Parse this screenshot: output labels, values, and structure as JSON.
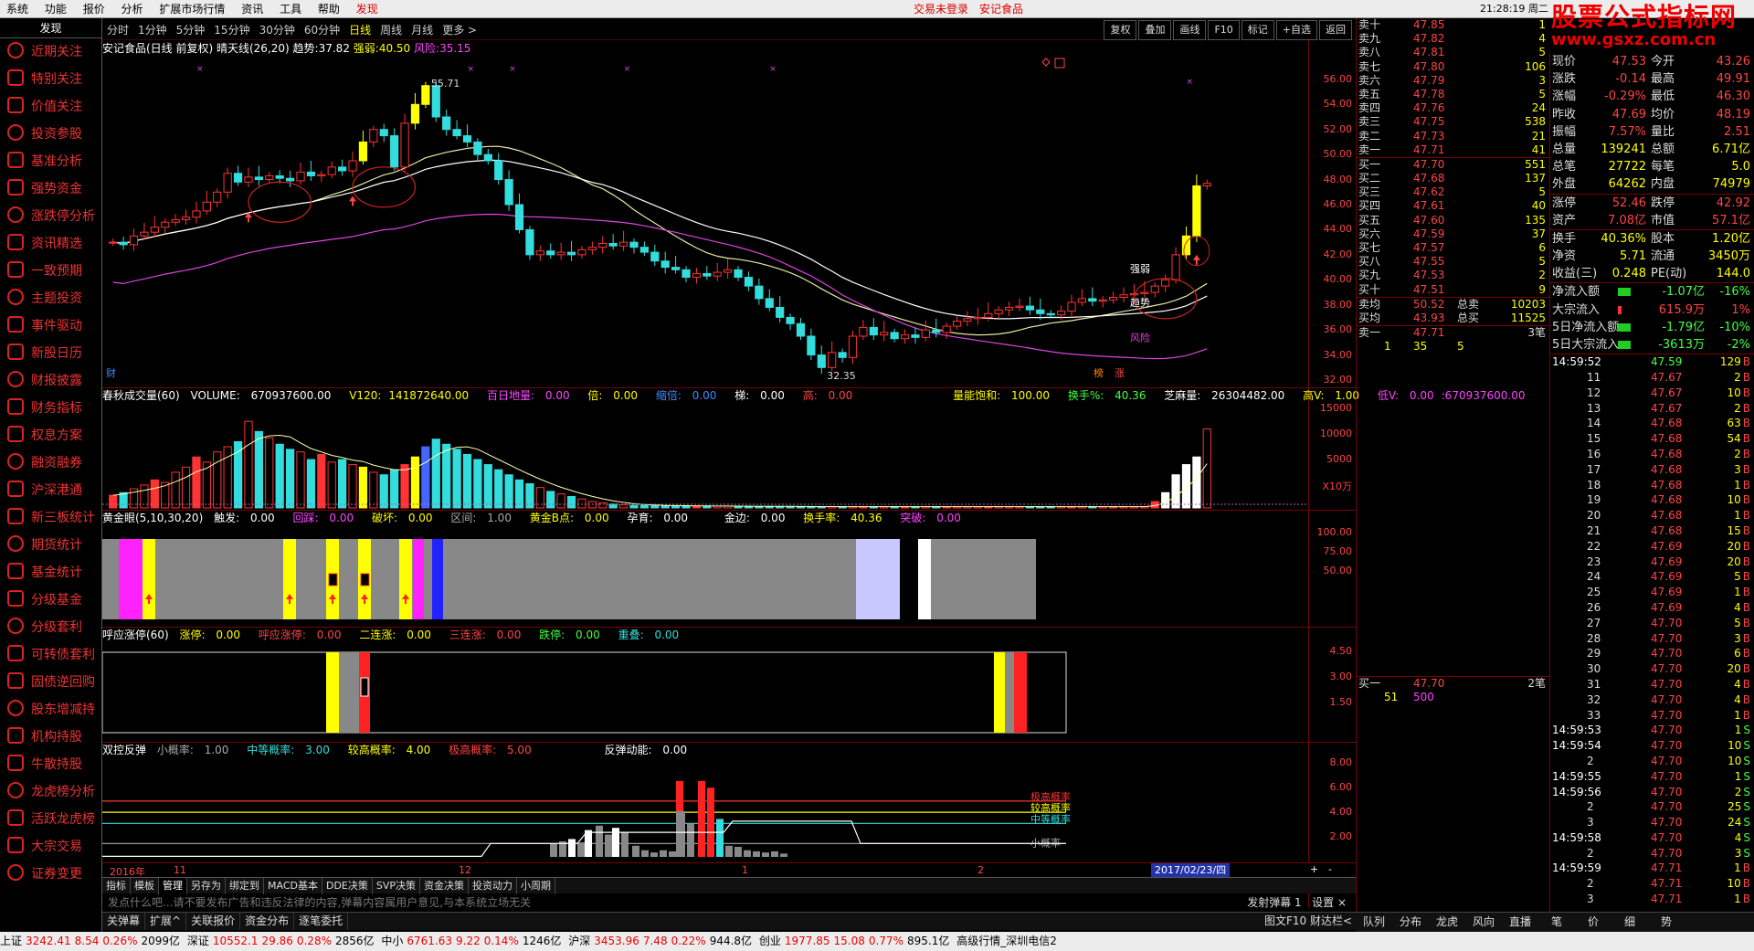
{
  "menubar": {
    "items": [
      "系统",
      "功能",
      "报价",
      "分析",
      "扩展市场行情",
      "资讯",
      "工具",
      "帮助"
    ],
    "active": "发现",
    "status1": "交易未登录",
    "status2": "安记食品",
    "time": "21:28:19 周二"
  },
  "logo": {
    "l1": "股票公式指标网",
    "l2": "www.gsxz.com.cn"
  },
  "sidebar": {
    "head": "发现",
    "items": [
      "近期关注",
      "特别关注",
      "价值关注",
      "投资参股",
      "基准分析",
      "强势资金",
      "涨跌停分析",
      "资讯精选",
      "一致预期",
      "主题投资",
      "事件驱动",
      "新股日历",
      "财报披露",
      "财务指标",
      "权息方案",
      "融资融券",
      "沪深港通",
      "新三板统计",
      "期货统计",
      "基金统计",
      "分级基金",
      "分级套利",
      "可转债套利",
      "固债逆回购",
      "股东增减持",
      "机构持股",
      "牛散持股",
      "龙虎榜分析",
      "活跃龙虎榜",
      "大宗交易",
      "证券变更"
    ]
  },
  "periodtabs": {
    "items": [
      "分时",
      "1分钟",
      "5分钟",
      "15分钟",
      "30分钟",
      "60分钟",
      "日线",
      "周线",
      "月线",
      "更多 >"
    ],
    "active": "日线",
    "right": [
      "复权",
      "叠加",
      "画线",
      "F10",
      "标记",
      "+自选",
      "返回"
    ]
  },
  "mainchart": {
    "title": "安记食品(日线 前复权) 晴天线(26,20)",
    "trend_l": "趋势:",
    "trend_v": "37.82",
    "strong_l": "强弱:",
    "strong_v": "40.50",
    "risk_l": "风险:",
    "risk_v": "35.15",
    "high_mark": "55.71",
    "low_mark": "32.35",
    "axis": [
      "56.00",
      "54.00",
      "52.00",
      "50.00",
      "48.00",
      "46.00",
      "44.00",
      "42.00",
      "40.00",
      "38.00",
      "36.00",
      "34.00",
      "32.00"
    ],
    "lbl_strong": "强弱",
    "lbl_trend": "趋势",
    "lbl_risk": "风险",
    "cai": "财",
    "tag1": "榜",
    "tag2": "涨"
  },
  "chart_data": {
    "type": "line",
    "title": "安记食品(日线 前复权)",
    "close": [
      43.0,
      42.8,
      43.5,
      43.8,
      44.2,
      44.6,
      44.8,
      45.0,
      45.5,
      46.2,
      47.0,
      48.5,
      47.8,
      48.2,
      48.0,
      48.3,
      48.1,
      47.9,
      48.6,
      48.3,
      48.4,
      49.0,
      48.7,
      49.5,
      51.0,
      52.0,
      51.5,
      49.0,
      52.5,
      54.0,
      55.5,
      53.0,
      52.0,
      51.5,
      51.0,
      50.0,
      49.5,
      48.0,
      46.0,
      44.0,
      42.0,
      42.3,
      42.0,
      42.2,
      42.0,
      42.4,
      42.6,
      42.9,
      42.7,
      43.0,
      42.6,
      42.2,
      41.5,
      41.0,
      40.8,
      40.2,
      40.5,
      40.3,
      40.6,
      40.8,
      40.2,
      39.5,
      38.5,
      37.8,
      37.0,
      36.5,
      35.5,
      34.0,
      33.0,
      34.2,
      33.8,
      35.5,
      36.2,
      35.6,
      35.8,
      35.3,
      35.6,
      35.4,
      36.0,
      35.8,
      36.3,
      36.7,
      36.9,
      37.0,
      37.3,
      37.6,
      37.8,
      37.9,
      37.6,
      37.3,
      37.2,
      37.5,
      38.2,
      38.5,
      38.3,
      38.4,
      38.6,
      38.8,
      38.9,
      39.0,
      39.5,
      40.0,
      42.0,
      43.5,
      47.5,
      47.7
    ],
    "axis_min": 32,
    "axis_max": 56.5
  },
  "volpanel": {
    "title": "春秋成交量(60)",
    "vol_l": "VOLUME:",
    "vol_v": "670937600.00",
    "v120_l": "V120:",
    "v120_v": "141872640.00",
    "pq_l": "百日地量:",
    "pq_v": "0.00",
    "bei_l": "倍:",
    "bei_v": "0.00",
    "hy_l": "缩倍:",
    "hy_v": "0.00",
    "zhu_l": "梯:",
    "zhu_v": "0.00",
    "gao_l": "高:",
    "gao_v": "0.00",
    "bh_l": "量能饱和:",
    "bh_v": "100.00",
    "hs_l": "换手%:",
    "hs_v": "40.36",
    "zm_l": "芝麻量:",
    "zm_v": "26304482.00",
    "gv_l": "高V:",
    "gv_v": "1.00",
    "dv_l": "低V:",
    "dv_v": "0.00",
    "dv_v2": ":670937600.00",
    "axis": [
      "15000",
      "10000",
      "5000"
    ],
    "unit": "X10万",
    "values": [
      1.0,
      1.2,
      1.5,
      1.8,
      2.2,
      2.0,
      2.8,
      3.2,
      4.0,
      3.6,
      4.4,
      4.8,
      5.2,
      6.8,
      6.0,
      5.5,
      5.0,
      4.6,
      4.4,
      3.8,
      4.2,
      3.6,
      3.8,
      3.4,
      3.2,
      2.8,
      2.6,
      3.0,
      3.4,
      4.0,
      4.8,
      5.4,
      5.0,
      4.6,
      4.2,
      3.8,
      3.4,
      3.0,
      2.6,
      2.2,
      1.9,
      1.6,
      1.3,
      1.1,
      0.9,
      0.7,
      0.5,
      0.4,
      0.3,
      0.25,
      0.2,
      0.2,
      0.18,
      0.18,
      0.16,
      0.16,
      0.15,
      0.15,
      0.14,
      0.14,
      0.13,
      0.13,
      0.12,
      0.12,
      0.12,
      0.11,
      0.11,
      0.1,
      0.1,
      0.1,
      0.1,
      0.1,
      0.1,
      0.1,
      0.1,
      0.1,
      0.1,
      0.1,
      0.1,
      0.1,
      0.1,
      0.1,
      0.1,
      0.1,
      0.1,
      0.1,
      0.1,
      0.1,
      0.1,
      0.1,
      0.1,
      0.1,
      0.1,
      0.1,
      0.1,
      0.1,
      0.1,
      0.1,
      0.1,
      0.1,
      0.5,
      1.2,
      2.6,
      3.4,
      4.0,
      6.2
    ]
  },
  "p3": {
    "title": "黄金眼(5,10,30,20)",
    "cf_l": "触发:",
    "cf_v": "0.00",
    "hj_l": "回踩:",
    "hj_v": "0.00",
    "pk_l": "破坏:",
    "pk_v": "0.00",
    "qj_l": "区间:",
    "qj_v": "1.00",
    "hjb_l": "黄金B点:",
    "hjb_v": "0.00",
    "yz_l": "孕育:",
    "yz_v": "0.00",
    "jb_l": "金边:",
    "jb_v": "0.00",
    "hs_l": "换手率:",
    "hs_v": "40.36",
    "tp_l": "突破:",
    "tp_v": "0.00",
    "axis": [
      "100.00",
      "75.00",
      "50.00"
    ]
  },
  "p4": {
    "title": "呼应涨停(60)",
    "zt_l": "涨停:",
    "zt_v": "0.00",
    "hy_l": "呼应涨停:",
    "hy_v": "0.00",
    "el_l": "二连涨:",
    "el_v": "0.00",
    "sl_l": "三连涨:",
    "sl_v": "0.00",
    "dt_l": "跌停:",
    "dt_v": "0.00",
    "cd_l": "重叠:",
    "cd_v": "0.00",
    "axis": [
      "4.50",
      "3.00",
      "1.50"
    ]
  },
  "p5": {
    "title": "双控反弹",
    "xg_l": "小概率:",
    "xg_v": "1.00",
    "zd_l": "中等概率:",
    "zd_v": "3.00",
    "jg_l": "较高概率:",
    "jg_v": "4.00",
    "jgg_l": "极高概率:",
    "jgg_v": "5.00",
    "fd_l": "反弹动能:",
    "fd_v": "0.00",
    "axis": [
      "8.00",
      "6.00",
      "4.00",
      "2.00"
    ],
    "lbls": [
      "极高概率",
      "较高概率",
      "中等概率",
      "小概率"
    ]
  },
  "datebar": {
    "d1": "2016年",
    "d2": "11",
    "d3": "12",
    "d4": "1",
    "d5": "2",
    "d6": "2017/02/23/四"
  },
  "tabs2": {
    "items": [
      "指标",
      "模板",
      "管理",
      "另存为",
      "绑定到",
      "MACD基本",
      "DDE决策",
      "SVP决策",
      "资金决策",
      "投资动力",
      "小周期"
    ],
    "active": "管理"
  },
  "notice": {
    "text": "发点什么吧...请不要发布广告和违反法律的内容,弹幕内容属用户意见,与本系统立场无关",
    "r1": "发射弹幕",
    "r2": "1",
    "r3": "设置 ×"
  },
  "bottom1": {
    "items": [
      "关弹幕",
      "扩展^",
      "关联报价",
      "资金分布",
      "逐笔委托"
    ],
    "right": "图文F10  财达栏<"
  },
  "sell": [
    {
      "n": "卖十",
      "p": "47.85",
      "v": "1"
    },
    {
      "n": "卖九",
      "p": "47.82",
      "v": "4"
    },
    {
      "n": "卖八",
      "p": "47.81",
      "v": "5"
    },
    {
      "n": "卖七",
      "p": "47.80",
      "v": "106"
    },
    {
      "n": "卖六",
      "p": "47.79",
      "v": "3"
    },
    {
      "n": "卖五",
      "p": "47.78",
      "v": "5"
    },
    {
      "n": "卖四",
      "p": "47.76",
      "v": "24"
    },
    {
      "n": "卖三",
      "p": "47.75",
      "v": "538"
    },
    {
      "n": "卖二",
      "p": "47.73",
      "v": "21"
    },
    {
      "n": "卖一",
      "p": "47.71",
      "v": "41"
    }
  ],
  "buy": [
    {
      "n": "买一",
      "p": "47.70",
      "v": "551"
    },
    {
      "n": "买二",
      "p": "47.68",
      "v": "137"
    },
    {
      "n": "买三",
      "p": "47.62",
      "v": "5"
    },
    {
      "n": "买四",
      "p": "47.61",
      "v": "40"
    },
    {
      "n": "买五",
      "p": "47.60",
      "v": "135"
    },
    {
      "n": "买六",
      "p": "47.59",
      "v": "37"
    },
    {
      "n": "买七",
      "p": "47.57",
      "v": "6"
    },
    {
      "n": "买八",
      "p": "47.55",
      "v": "5"
    },
    {
      "n": "买九",
      "p": "47.53",
      "v": "2"
    },
    {
      "n": "买十",
      "p": "47.51",
      "v": "9"
    }
  ],
  "avg": {
    "a1": "卖均",
    "a1v": "50.52",
    "a1c": "总卖",
    "a1cv": "10203",
    "a2": "买均",
    "a2v": "43.93",
    "a2c": "总买",
    "a2cv": "11525"
  },
  "queue1": {
    "n": "卖一",
    "p": "47.71",
    "c": "3笔",
    "q1": "1",
    "q2": "35",
    "q3": "5"
  },
  "queue2": {
    "n": "买一",
    "p": "47.70",
    "c": "2笔",
    "q1": "51",
    "q2": "500"
  },
  "stats": [
    [
      "现价",
      "47.53",
      "今开",
      "43.26"
    ],
    [
      "涨跌",
      "-0.14",
      "最高",
      "49.91"
    ],
    [
      "涨幅",
      "-0.29%",
      "最低",
      "46.30"
    ],
    [
      "昨收",
      "47.69",
      "均价",
      "48.19"
    ],
    [
      "振幅",
      "7.57%",
      "量比",
      "2.51"
    ],
    [
      "总量",
      "139241",
      "总额",
      "6.71亿"
    ],
    [
      "总笔",
      "27722",
      "每笔",
      "5.0"
    ],
    [
      "外盘",
      "64262",
      "内盘",
      "74979"
    ]
  ],
  "stats2": [
    [
      "涨停",
      "52.46",
      "跌停",
      "42.92"
    ],
    [
      "资产",
      "7.08亿",
      "市值",
      "57.1亿"
    ]
  ],
  "stats3": [
    [
      "换手",
      "40.36%",
      "股本",
      "1.20亿"
    ],
    [
      "净资",
      "5.71",
      "流通",
      "3450万"
    ],
    [
      "收益(三)",
      "0.248",
      "PE(动)",
      "144.0"
    ]
  ],
  "flows": [
    [
      "净流入额",
      "-1.07亿",
      "-16%"
    ],
    [
      "大宗流入",
      "615.9万",
      "1%"
    ],
    [
      "5日净流入额",
      "-1.79亿",
      "-10%"
    ],
    [
      "5日大宗流入",
      "-3613万",
      "-2%"
    ]
  ],
  "ticks": [
    [
      "14:59:52",
      "47.59",
      "129",
      "B"
    ],
    [
      "11",
      "47.67",
      "2",
      "B"
    ],
    [
      "12",
      "47.67",
      "10",
      "B"
    ],
    [
      "13",
      "47.67",
      "2",
      "B"
    ],
    [
      "14",
      "47.68",
      "63",
      "B"
    ],
    [
      "15",
      "47.68",
      "54",
      "B"
    ],
    [
      "16",
      "47.68",
      "2",
      "B"
    ],
    [
      "17",
      "47.68",
      "3",
      "B"
    ],
    [
      "18",
      "47.68",
      "1",
      "B"
    ],
    [
      "19",
      "47.68",
      "10",
      "B"
    ],
    [
      "20",
      "47.68",
      "1",
      "B"
    ],
    [
      "21",
      "47.68",
      "15",
      "B"
    ],
    [
      "22",
      "47.69",
      "20",
      "B"
    ],
    [
      "23",
      "47.69",
      "20",
      "B"
    ],
    [
      "24",
      "47.69",
      "5",
      "B"
    ],
    [
      "25",
      "47.69",
      "1",
      "B"
    ],
    [
      "26",
      "47.69",
      "4",
      "B"
    ],
    [
      "27",
      "47.70",
      "5",
      "B"
    ],
    [
      "28",
      "47.70",
      "3",
      "B"
    ],
    [
      "29",
      "47.70",
      "6",
      "B"
    ],
    [
      "30",
      "47.70",
      "20",
      "B"
    ],
    [
      "31",
      "47.70",
      "4",
      "B"
    ],
    [
      "32",
      "47.70",
      "4",
      "B"
    ],
    [
      "33",
      "47.70",
      "1",
      "B"
    ],
    [
      "14:59:53",
      "47.70",
      "1",
      "S"
    ],
    [
      "14:59:54",
      "47.70",
      "10",
      "S"
    ],
    [
      "2",
      "47.70",
      "10",
      "S"
    ],
    [
      "14:59:55",
      "47.70",
      "1",
      "S"
    ],
    [
      "14:59:56",
      "47.70",
      "2",
      "S"
    ],
    [
      "2",
      "47.70",
      "25",
      "S"
    ],
    [
      "3",
      "47.70",
      "24",
      "S"
    ],
    [
      "14:59:58",
      "47.70",
      "4",
      "S"
    ],
    [
      "2",
      "47.70",
      "3",
      "S"
    ],
    [
      "14:59:59",
      "47.71",
      "1",
      "B"
    ],
    [
      "2",
      "47.71",
      "10",
      "B"
    ],
    [
      "3",
      "47.71",
      "1",
      "B"
    ]
  ],
  "rtabs": [
    "队列",
    "分布",
    "龙虎",
    "风向",
    "直播",
    "笔",
    "价",
    "细",
    "势"
  ],
  "statusbar": {
    "s1": "上证",
    "s1v": "3242.41",
    "s1c": "8.54",
    "s1p": "0.26%",
    "s1a": "2099亿",
    "s2": "深证",
    "s2v": "10552.1",
    "s2c": "29.86",
    "s2p": "0.28%",
    "s2a": "2856亿",
    "s3": "中小",
    "s3v": "6761.63",
    "s3c": "9.22",
    "s3p": "0.14%",
    "s3a": "1246亿",
    "s4": "沪深",
    "s4v": "3453.96",
    "s4c": "7.48",
    "s4p": "0.22%",
    "s4a": "944.8亿",
    "s5": "创业",
    "s5v": "1977.85",
    "s5c": "15.08",
    "s5p": "0.77%",
    "s5a": "895.1亿",
    "s6": "高级行情_深圳电信2"
  }
}
